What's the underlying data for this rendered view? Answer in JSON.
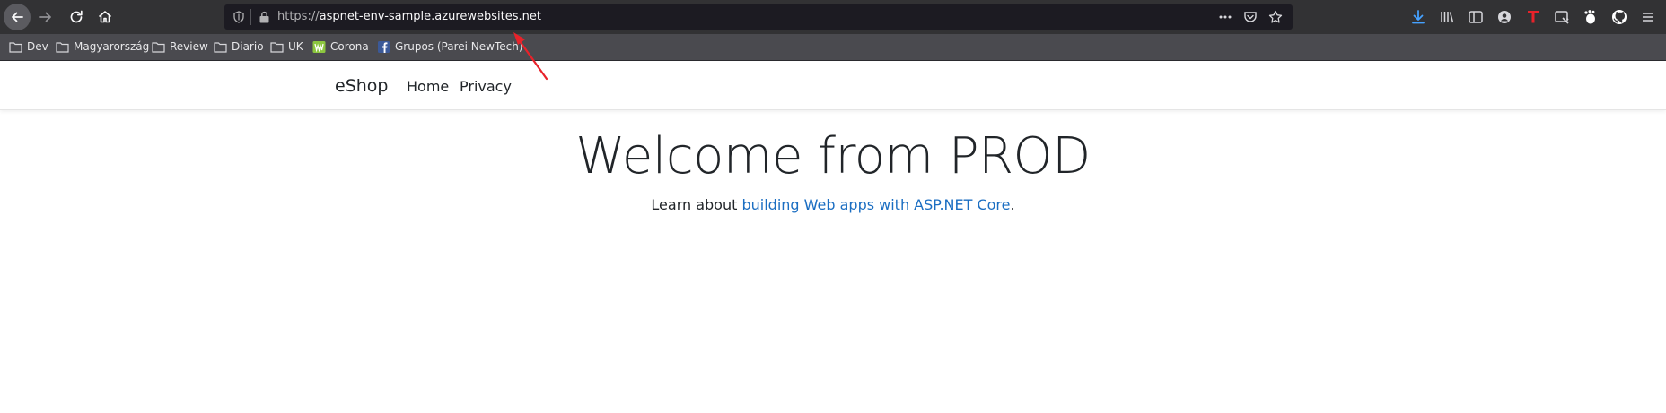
{
  "browser": {
    "url_scheme": "https://",
    "url_host": "aspnet-env-sample.azurewebsites.net",
    "bookmarks": [
      {
        "label": "Dev",
        "icon": "folder-icon"
      },
      {
        "label": "Magyarország",
        "icon": "folder-icon"
      },
      {
        "label": "Review",
        "icon": "folder-icon"
      },
      {
        "label": "Diario",
        "icon": "folder-icon"
      },
      {
        "label": "UK",
        "icon": "folder-icon"
      },
      {
        "label": "Corona",
        "icon": "w-site-icon"
      },
      {
        "label": "Grupos (Parei NewTech)",
        "icon": "facebook-icon"
      }
    ],
    "colors": {
      "toolbar": "#323234",
      "bookmarks_bar": "#4a4a4f",
      "urlbar": "#1c1b22",
      "download_accent": "#45a1ff"
    }
  },
  "site": {
    "brand": "eShop",
    "nav": {
      "home": "Home",
      "privacy": "Privacy"
    },
    "hero": {
      "title": "Welcome from PROD",
      "lead_prefix": "Learn about ",
      "link_text": "building Web apps with ASP.NET Core",
      "lead_suffix": "."
    },
    "colors": {
      "text": "#212529",
      "link": "#1b6ec2"
    }
  },
  "annotation": {
    "arrow_color": "#e8222a"
  }
}
